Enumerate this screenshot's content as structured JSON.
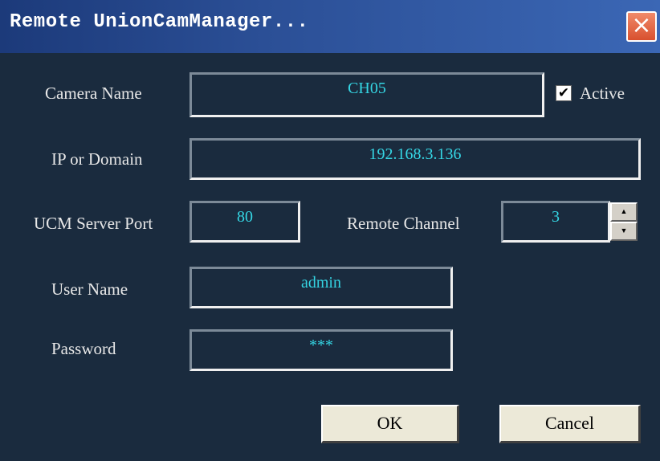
{
  "window": {
    "title": "Remote UnionCamManager..."
  },
  "colors": {
    "titlebar": "#2b4f96",
    "background": "#1a2b3e",
    "field_text": "#35d6e4",
    "close": "#d8502e"
  },
  "form": {
    "camera_name": {
      "label": "Camera Name",
      "value": "CH05"
    },
    "active": {
      "label": "Active",
      "checked": true
    },
    "ip_domain": {
      "label": "IP or Domain",
      "value": "192.168.3.136"
    },
    "ucm_port": {
      "label": "UCM Server Port",
      "value": "80"
    },
    "remote_channel": {
      "label": "Remote Channel",
      "value": "3"
    },
    "user_name": {
      "label": "User Name",
      "value": "admin"
    },
    "password": {
      "label": "Password",
      "value": "***"
    }
  },
  "buttons": {
    "ok": "OK",
    "cancel": "Cancel"
  },
  "icons": {
    "close": "close-icon",
    "check": "check-icon",
    "spin_up": "arrow-up-icon",
    "spin_down": "arrow-down-icon"
  }
}
